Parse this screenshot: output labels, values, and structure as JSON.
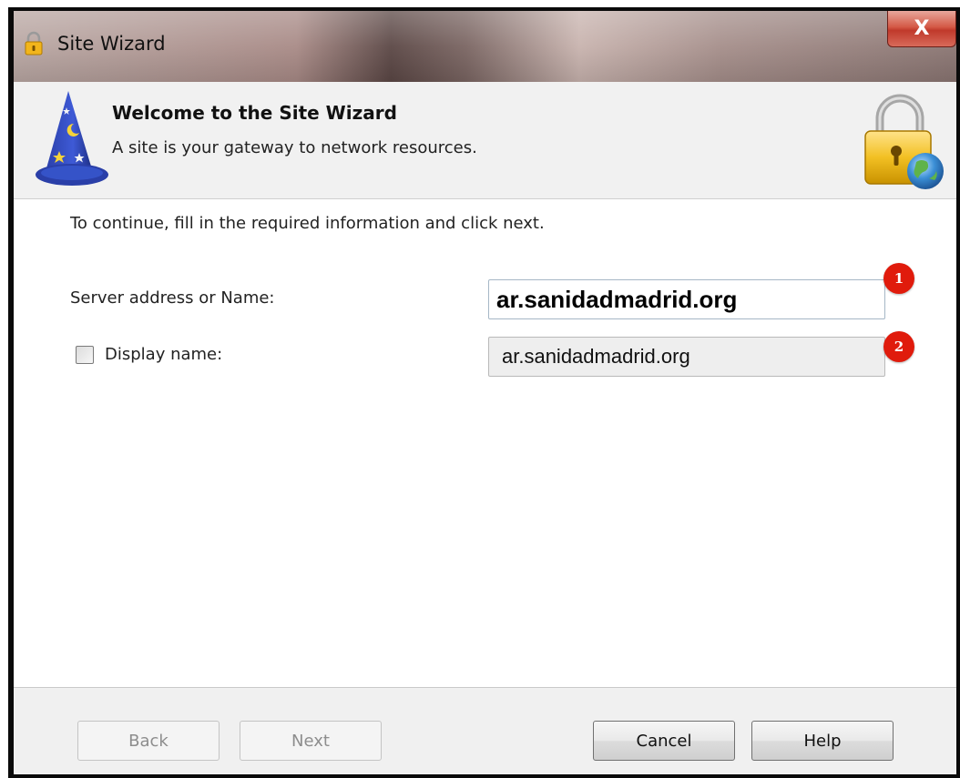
{
  "window": {
    "title": "Site Wizard",
    "close_label": "X",
    "icon": "padlock-icon"
  },
  "header": {
    "title": "Welcome to the Site Wizard",
    "subtitle": "A site is your gateway to network resources.",
    "left_icon": "wizard-hat-icon",
    "right_icon": "padlock-globe-icon"
  },
  "form": {
    "instructions": "To continue, fill in the required information and click next.",
    "server": {
      "label": "Server address or Name:",
      "value": "ar.sanidadmadrid.org"
    },
    "display_name": {
      "label": "Display name:",
      "value": "ar.sanidadmadrid.org",
      "checked": false
    }
  },
  "markers": [
    "1",
    "2"
  ],
  "buttons": {
    "back": "Back",
    "next": "Next",
    "cancel": "Cancel",
    "help": "Help"
  },
  "colors": {
    "marker": "#e01b0c",
    "close_button": "#c0392b"
  }
}
